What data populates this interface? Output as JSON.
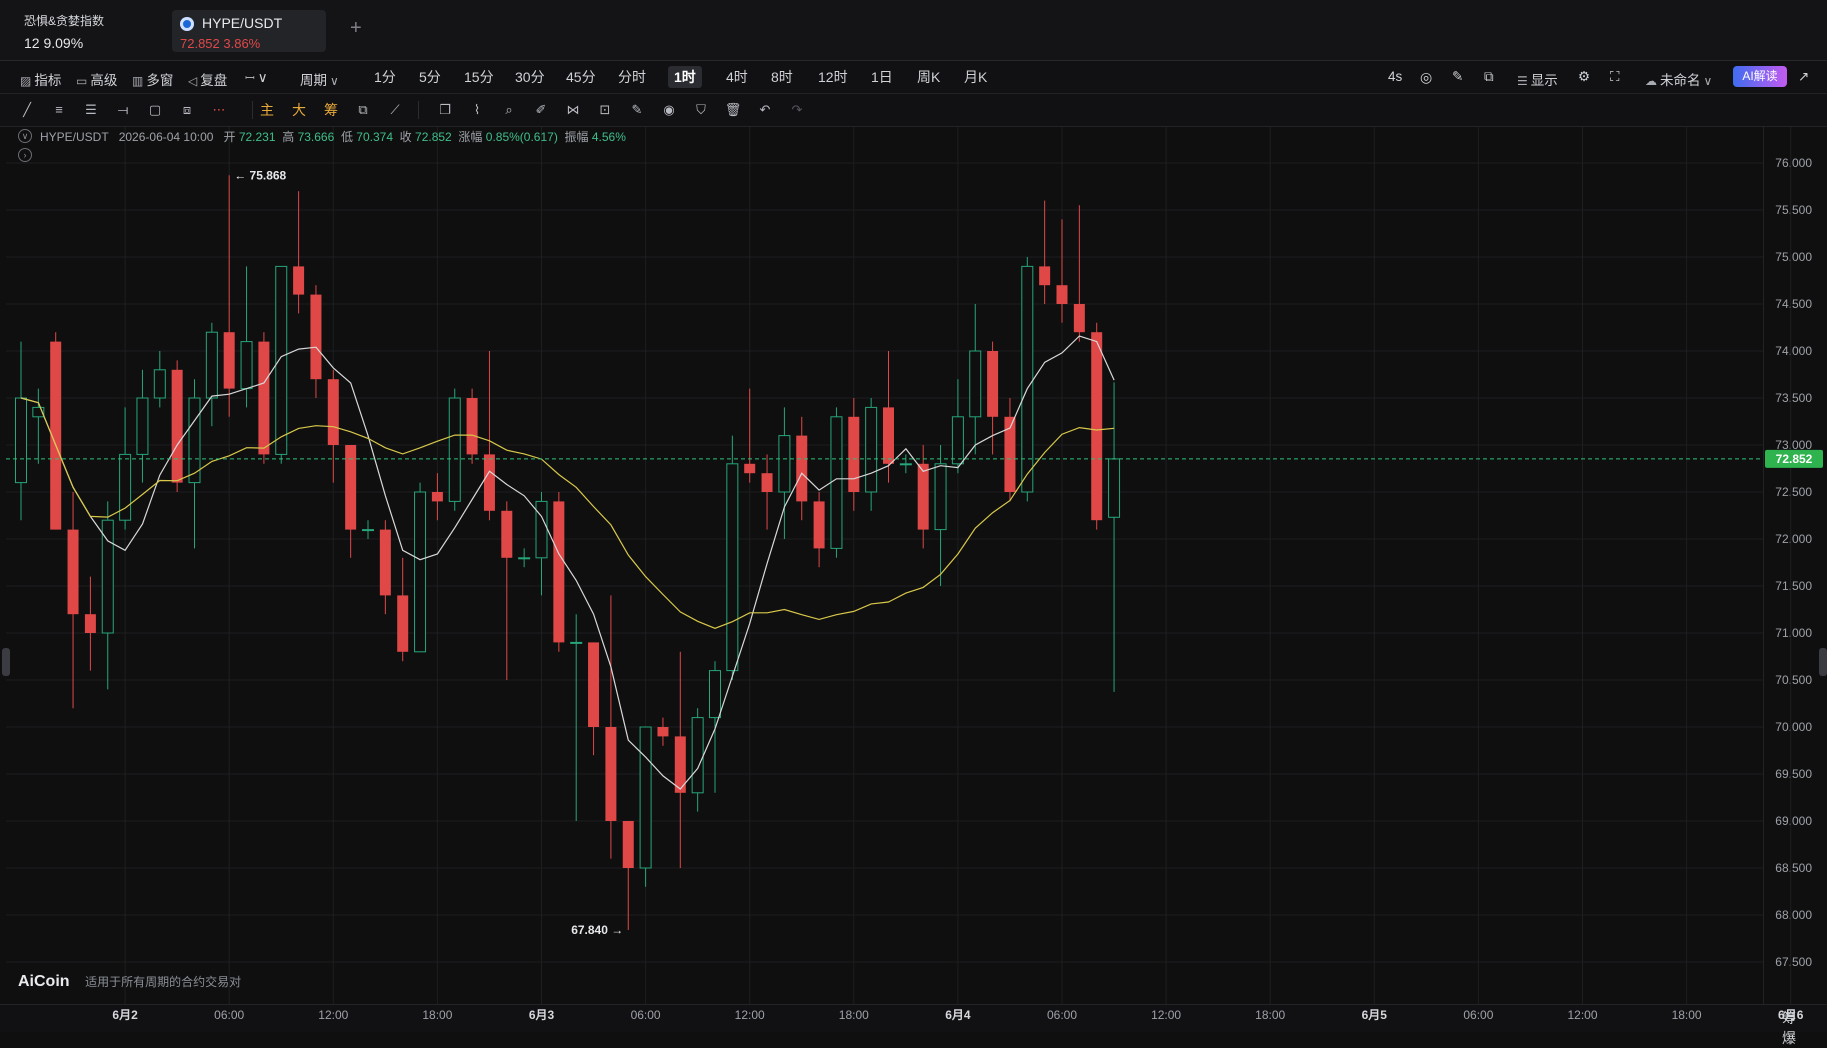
{
  "header": {
    "fear_greed": {
      "title": "恐惧&贪婪指数",
      "value": "12 9.09%"
    },
    "pair_tab": {
      "name": "HYPE/USDT",
      "price": "72.852 3.86%"
    },
    "add_tab": "+"
  },
  "toolbar": {
    "left_items": [
      {
        "icon": "indicator-icon",
        "glyph": "▨",
        "label": "指标"
      },
      {
        "icon": "advanced-icon",
        "glyph": "▭",
        "label": "高级"
      },
      {
        "icon": "multi-window-icon",
        "glyph": "▥",
        "label": "多窗"
      },
      {
        "icon": "replay-icon",
        "glyph": "◁",
        "label": "复盘"
      },
      {
        "icon": "candle-type-icon",
        "glyph": "ꟷ",
        "label": "∨"
      }
    ],
    "period_label": "周期",
    "periods": [
      "1分",
      "5分",
      "15分",
      "30分",
      "45分",
      "分时",
      "1时",
      "4时",
      "8时",
      "12时",
      "1日",
      "周K",
      "月K"
    ],
    "active_period": "1时",
    "right_items": {
      "refresh": "4s",
      "display": "显示",
      "unnamed": "未命名",
      "ai": "AI解读"
    }
  },
  "drawing_tools": {
    "text_tools": [
      "主",
      "大",
      "筹"
    ]
  },
  "info": {
    "symbol": "HYPE/USDT",
    "time": "2026-06-04 10:00",
    "open_label": "开",
    "open": "72.231",
    "high_label": "高",
    "high": "73.666",
    "low_label": "低",
    "low": "70.374",
    "close_label": "收",
    "close": "72.852",
    "change_label": "涨幅",
    "change": "0.85%(0.617)",
    "amp_label": "振幅",
    "amp": "4.56%"
  },
  "watermark": {
    "logo": "AiCoin",
    "text": "适用于所有周期的合约交易对"
  },
  "corner": "筹 爆",
  "colors": {
    "up": "#26a67a",
    "down": "#e04848",
    "ma_short": "#d8d8d8",
    "ma_long": "#d9c84a",
    "price_line": "#2ec27e",
    "price_tag": "#2fb34f"
  },
  "chart_data": {
    "type": "candlestick",
    "symbol": "HYPE/USDT",
    "interval": "1时",
    "y_ticks": [
      "67.500",
      "68.000",
      "68.500",
      "69.000",
      "69.500",
      "70.000",
      "70.500",
      "71.000",
      "71.500",
      "72.000",
      "72.500",
      "73.000",
      "73.500",
      "74.000",
      "74.500",
      "75.000",
      "75.500",
      "76.000"
    ],
    "ylim": [
      67.2,
      76.2
    ],
    "x_ticks": [
      {
        "i": 6,
        "label": "6月2"
      },
      {
        "i": 12,
        "label": "06:00"
      },
      {
        "i": 18,
        "label": "12:00"
      },
      {
        "i": 24,
        "label": "18:00"
      },
      {
        "i": 30,
        "label": "6月3"
      },
      {
        "i": 36,
        "label": "06:00"
      },
      {
        "i": 42,
        "label": "12:00"
      },
      {
        "i": 48,
        "label": "18:00"
      },
      {
        "i": 54,
        "label": "6月4"
      },
      {
        "i": 60,
        "label": "06:00"
      },
      {
        "i": 66,
        "label": "12:00"
      },
      {
        "i": 72,
        "label": "18:00"
      },
      {
        "i": 78,
        "label": "6月5"
      },
      {
        "i": 84,
        "label": "06:00"
      },
      {
        "i": 90,
        "label": "12:00"
      },
      {
        "i": 96,
        "label": "18:00"
      },
      {
        "i": 102,
        "label": "6月6"
      }
    ],
    "candles": [
      [
        72.6,
        73.5,
        74.1,
        72.2
      ],
      [
        73.3,
        73.4,
        73.6,
        72.8
      ],
      [
        74.1,
        72.1,
        74.2,
        72.1
      ],
      [
        72.1,
        71.2,
        72.5,
        70.2
      ],
      [
        71.2,
        71.0,
        71.6,
        70.6
      ],
      [
        71.0,
        72.2,
        72.4,
        70.4
      ],
      [
        72.2,
        72.9,
        73.4,
        72.1
      ],
      [
        72.9,
        73.5,
        73.8,
        72.6
      ],
      [
        73.5,
        73.8,
        74.0,
        73.4
      ],
      [
        73.8,
        72.6,
        73.9,
        72.5
      ],
      [
        72.6,
        73.5,
        73.7,
        71.9
      ],
      [
        73.5,
        74.2,
        74.3,
        73.2
      ],
      [
        74.2,
        73.6,
        75.87,
        73.3
      ],
      [
        73.6,
        74.1,
        74.9,
        73.4
      ],
      [
        74.1,
        72.9,
        74.2,
        72.8
      ],
      [
        72.9,
        74.9,
        74.9,
        72.8
      ],
      [
        74.9,
        74.6,
        75.7,
        74.4
      ],
      [
        74.6,
        73.7,
        74.7,
        73.5
      ],
      [
        73.7,
        73.0,
        73.8,
        72.6
      ],
      [
        73.0,
        72.1,
        73.0,
        71.8
      ],
      [
        72.1,
        72.1,
        72.2,
        72.0
      ],
      [
        72.1,
        71.4,
        72.2,
        71.2
      ],
      [
        71.4,
        70.8,
        71.8,
        70.7
      ],
      [
        70.8,
        72.5,
        72.6,
        70.8
      ],
      [
        72.5,
        72.4,
        72.7,
        72.2
      ],
      [
        72.4,
        73.5,
        73.6,
        72.3
      ],
      [
        73.5,
        72.9,
        73.6,
        72.8
      ],
      [
        72.9,
        72.3,
        74.0,
        72.2
      ],
      [
        72.3,
        71.8,
        72.4,
        70.5
      ],
      [
        71.8,
        71.8,
        71.9,
        71.7
      ],
      [
        71.8,
        72.4,
        72.5,
        71.4
      ],
      [
        72.4,
        70.9,
        72.5,
        70.8
      ],
      [
        70.9,
        70.9,
        71.2,
        69.0
      ],
      [
        70.9,
        70.0,
        70.9,
        69.7
      ],
      [
        70.0,
        69.0,
        71.4,
        68.6
      ],
      [
        69.0,
        68.5,
        69.0,
        67.84
      ],
      [
        68.5,
        70.0,
        70.0,
        68.3
      ],
      [
        70.0,
        69.9,
        70.1,
        69.8
      ],
      [
        69.9,
        69.3,
        70.8,
        68.5
      ],
      [
        69.3,
        70.1,
        70.2,
        69.1
      ],
      [
        70.1,
        70.6,
        70.7,
        69.3
      ],
      [
        70.6,
        72.8,
        73.1,
        70.5
      ],
      [
        72.8,
        72.7,
        73.6,
        72.6
      ],
      [
        72.7,
        72.5,
        72.9,
        72.1
      ],
      [
        72.5,
        73.1,
        73.4,
        72.0
      ],
      [
        73.1,
        72.4,
        73.3,
        72.2
      ],
      [
        72.4,
        71.9,
        72.5,
        71.7
      ],
      [
        71.9,
        73.3,
        73.4,
        71.8
      ],
      [
        73.3,
        72.5,
        73.5,
        72.3
      ],
      [
        72.5,
        73.4,
        73.5,
        72.3
      ],
      [
        73.4,
        72.8,
        74.0,
        72.6
      ],
      [
        72.8,
        72.8,
        72.9,
        72.7
      ],
      [
        72.8,
        72.1,
        73.0,
        71.9
      ],
      [
        72.1,
        72.8,
        73.0,
        71.5
      ],
      [
        72.8,
        73.3,
        73.7,
        72.7
      ],
      [
        73.3,
        74.0,
        74.5,
        72.9
      ],
      [
        74.0,
        73.3,
        74.1,
        72.9
      ],
      [
        73.3,
        72.5,
        73.5,
        72.4
      ],
      [
        72.5,
        74.9,
        75.0,
        72.4
      ],
      [
        74.9,
        74.7,
        75.6,
        74.5
      ],
      [
        74.7,
        74.5,
        75.4,
        74.3
      ],
      [
        74.5,
        74.2,
        75.55,
        74.1
      ],
      [
        74.2,
        72.2,
        74.3,
        72.1
      ],
      [
        72.231,
        72.852,
        73.666,
        70.374
      ]
    ],
    "annotations": [
      {
        "label": "← 75.868",
        "value": 75.868
      },
      {
        "label": "67.840 →",
        "value": 67.84
      }
    ],
    "current_price": 72.852
  }
}
